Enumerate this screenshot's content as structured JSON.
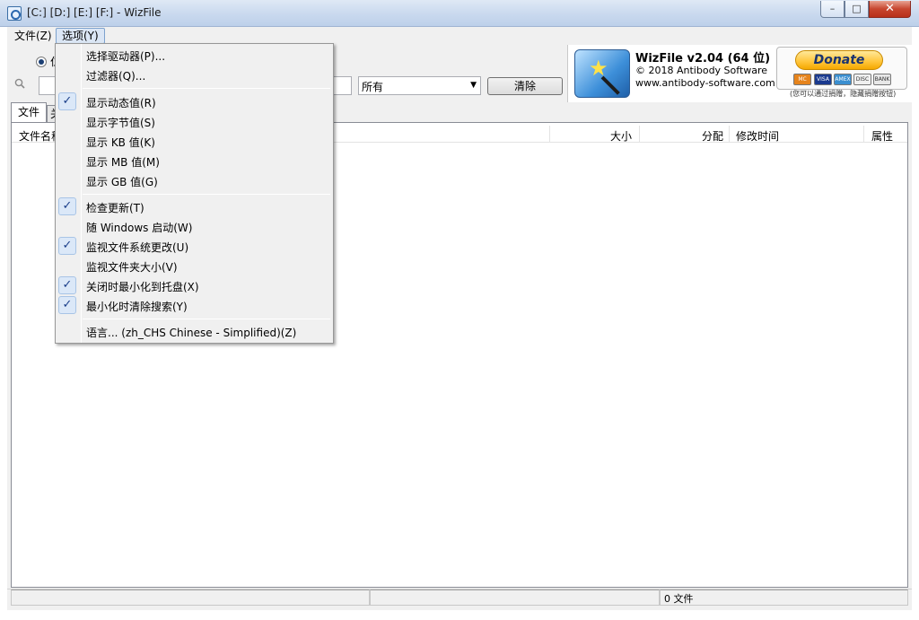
{
  "window": {
    "title": "[C:] [D:] [E:] [F:]  - WizFile",
    "min_glyph": "–",
    "max_glyph": "□",
    "close_glyph": "✕"
  },
  "menubar": {
    "file": "文件(Z)",
    "options": "选项(Y)"
  },
  "toolbar": {
    "radio_label_partial": "仁",
    "search_placeholder": "",
    "filter_value": "所有",
    "clear_label": "清除"
  },
  "branding": {
    "title": "WizFile v2.04 (64 位)",
    "copyright": "© 2018 Antibody Software",
    "url": "www.antibody-software.com",
    "donate_label": "Donate",
    "cards": [
      "MC",
      "VISA",
      "AMEX",
      "DISC",
      "BANK"
    ],
    "donate_note": "(您可以通过捐赠，隐藏捐赠按钮)"
  },
  "tabs": [
    {
      "label": "文件"
    },
    {
      "label": "关"
    }
  ],
  "list": {
    "columns": {
      "name": "文件名称",
      "size": "大小",
      "alloc": "分配",
      "modified": "修改时间",
      "attrs": "属性"
    }
  },
  "status": {
    "count": "0 文件"
  },
  "options_menu": {
    "select_drives": "选择驱动器(P)...",
    "filters": "过滤器(Q)...",
    "show_dynamic": "显示动态值(R)",
    "show_bytes": "显示字节值(S)",
    "show_kb": "显示 KB 值(K)",
    "show_mb": "显示 MB 值(M)",
    "show_gb": "显示 GB 值(G)",
    "check_updates": "检查更新(T)",
    "start_with_windows": "随 Windows 启动(W)",
    "monitor_fs": "监视文件系统更改(U)",
    "monitor_folder_size": "监视文件夹大小(V)",
    "minimize_to_tray": "关闭时最小化到托盘(X)",
    "clear_search_on_minimize": "最小化时清除搜索(Y)",
    "language": "语言... (zh_CHS Chinese - Simplified)(Z)",
    "check_glyph": "✓"
  }
}
